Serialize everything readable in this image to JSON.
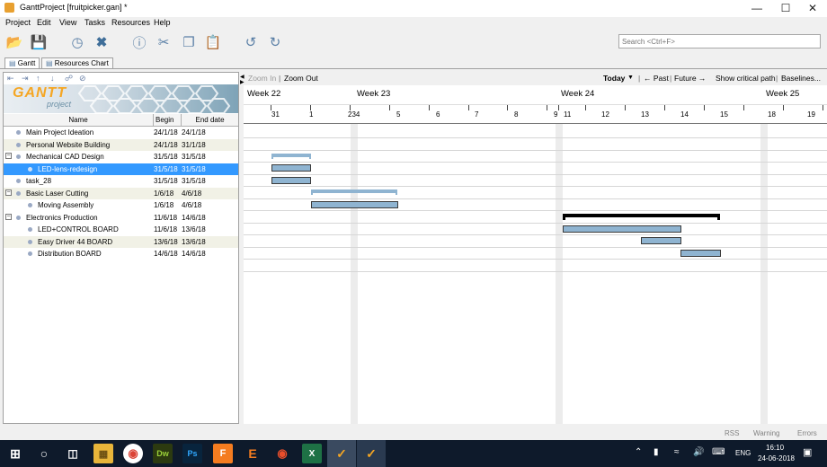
{
  "window": {
    "title": "GanttProject [fruitpicker.gan] *"
  },
  "menu": [
    "Project",
    "Edit",
    "View",
    "Tasks",
    "Resources",
    "Help"
  ],
  "search": {
    "placeholder": "Search <Ctrl+F>"
  },
  "tabs": [
    {
      "label": "Gantt"
    },
    {
      "label": "Resources Chart"
    }
  ],
  "logo": {
    "text": "GANTT",
    "sub": "project"
  },
  "table": {
    "headers": {
      "name": "Name",
      "begin": "Begin ...",
      "end": "End date"
    },
    "rows": [
      {
        "name": "Main Project Ideation",
        "begin": "24/1/18",
        "end": "24/1/18"
      },
      {
        "name": "Personal Website Building",
        "begin": "24/1/18",
        "end": "31/1/18"
      },
      {
        "name": "Mechanical CAD Design",
        "begin": "31/5/18",
        "end": "31/5/18"
      },
      {
        "name": "LED-lens-redesign",
        "begin": "31/5/18",
        "end": "31/5/18"
      },
      {
        "name": "task_28",
        "begin": "31/5/18",
        "end": "31/5/18"
      },
      {
        "name": "Basic Laser Cutting",
        "begin": "1/6/18",
        "end": "4/6/18"
      },
      {
        "name": "Moving Assembly",
        "begin": "1/6/18",
        "end": "4/6/18"
      },
      {
        "name": "Electronics Production",
        "begin": "11/6/18",
        "end": "14/6/18"
      },
      {
        "name": "LED+CONTROL BOARD",
        "begin": "11/6/18",
        "end": "13/6/18"
      },
      {
        "name": "Easy Driver 44 BOARD",
        "begin": "13/6/18",
        "end": "13/6/18"
      },
      {
        "name": "Distribution BOARD",
        "begin": "14/6/18",
        "end": "14/6/18"
      }
    ]
  },
  "chart": {
    "zoom_in": "Zoom In",
    "zoom_out": "Zoom Out",
    "today": "Today",
    "past": "← Past",
    "future": "Future →",
    "critical": "Show critical path",
    "baselines": "Baselines...",
    "weeks": [
      "Week 22",
      "Week 23",
      "Week 24",
      "Week 25"
    ],
    "days": [
      "31",
      "1",
      "234",
      "5",
      "6",
      "7",
      "8",
      "9",
      "11",
      "12",
      "13",
      "14",
      "15",
      "18",
      "19"
    ]
  },
  "status": {
    "rss": "RSS",
    "warning": "Warning",
    "errors": "Errors"
  },
  "taskbar": {
    "lang": "ENG",
    "time": "16:10",
    "date": "24-06-2018"
  },
  "colors": {
    "selection": "#3399ff",
    "bar": "#8fb4d1",
    "taskbar": "#0e1a2b",
    "logo_orange": "#f5a623"
  }
}
